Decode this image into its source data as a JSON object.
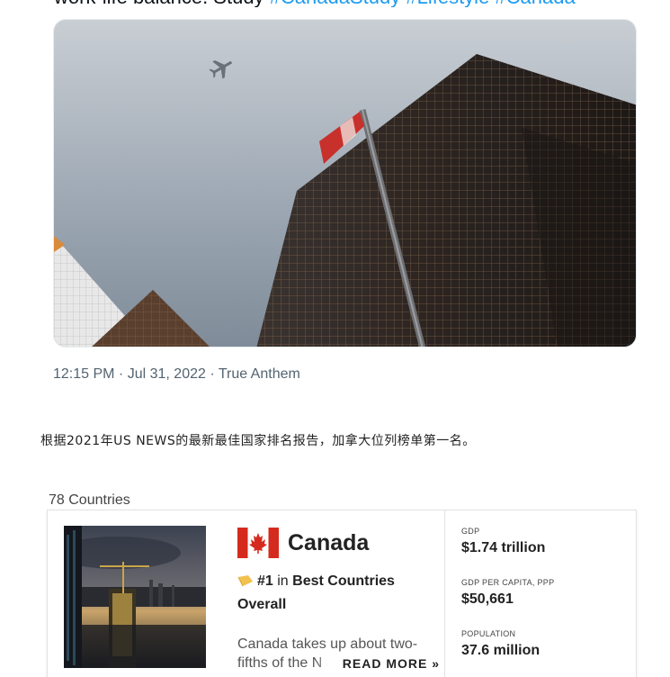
{
  "tweet": {
    "text_cutoff": "work-life balance. Study",
    "hashtags": "#CanadaStudy #Lifestyle #Canada",
    "meta": "12:15 PM · Jul 31, 2022 · True Anthem",
    "image_icons": [
      "airplane-icon",
      "canadian-flag"
    ]
  },
  "article": {
    "text": "根据2021年US NEWS的最新最佳国家排名报告，加拿大位列榜单第一名。"
  },
  "ranking": {
    "countries_count": "78 Countries",
    "card": {
      "country": "Canada",
      "rank": "#1",
      "rank_in": "in",
      "rank_category": "Best Countries",
      "rank_overall": "Overall",
      "description_line1": "Canada takes up about two-",
      "description_line2": "fifths of the N",
      "read_more": "READ MORE »",
      "stats": [
        {
          "label": "GDP",
          "value": "$1.74 trillion"
        },
        {
          "label": "GDP PER CAPITA, PPP",
          "value": "$50,661"
        },
        {
          "label": "POPULATION",
          "value": "37.6 million"
        }
      ]
    }
  },
  "colors": {
    "hashtag": "#1d9bf0",
    "flag_red": "#d52b1e",
    "medal": "#f2c14e"
  }
}
